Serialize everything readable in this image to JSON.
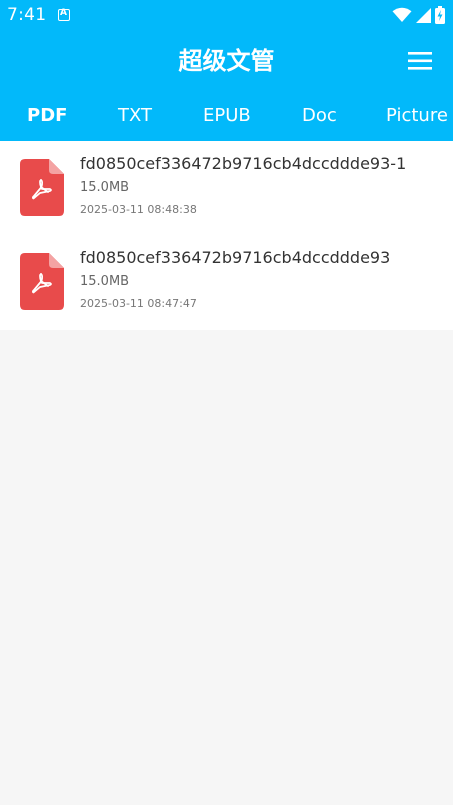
{
  "status_bar": {
    "time": "7:41"
  },
  "header": {
    "title": "超级文管"
  },
  "tabs": [
    {
      "label": "PDF",
      "active": true
    },
    {
      "label": "TXT",
      "active": false
    },
    {
      "label": "EPUB",
      "active": false
    },
    {
      "label": "Doc",
      "active": false
    },
    {
      "label": "Picture",
      "active": false
    }
  ],
  "files": [
    {
      "name": "fd0850cef336472b9716cb4dccddde93-1",
      "size": "15.0MB",
      "date": "2025-03-11 08:48:38"
    },
    {
      "name": "fd0850cef336472b9716cb4dccddde93",
      "size": "15.0MB",
      "date": "2025-03-11 08:47:47"
    }
  ],
  "colors": {
    "primary": "#02b9fa",
    "pdf_icon": "#e84b4b",
    "list_background": "#ffffff",
    "page_background": "#f6f6f6"
  },
  "icons": {
    "menu": "hamburger-menu-icon",
    "file": "pdf-file-icon",
    "wifi": "wifi-icon",
    "signal": "cellular-signal-icon",
    "battery": "battery-icon"
  }
}
